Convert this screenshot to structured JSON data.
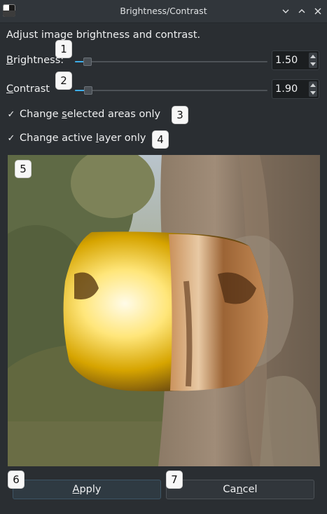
{
  "window": {
    "title": "Brightness/Contrast",
    "app_icon": "app-icon",
    "controls": [
      "chevron-down-icon",
      "chevron-up-icon",
      "close-icon"
    ]
  },
  "description": "Adjust image brightness and contrast.",
  "brightness": {
    "label": "Brightness:",
    "mnemonic": "B",
    "value": "1.50",
    "slider_fraction": 0.05
  },
  "contrast": {
    "label": "Contrast",
    "mnemonic": "C",
    "value": "1.90",
    "slider_fraction": 0.055
  },
  "options": {
    "selected_areas": {
      "label": "Change selected areas only",
      "checked": true
    },
    "active_layer": {
      "label": "Change active layer only",
      "checked": true
    }
  },
  "buttons": {
    "apply": "Apply",
    "cancel": "Cancel"
  },
  "badges": {
    "b1": "1",
    "b2": "2",
    "b3": "3",
    "b4": "4",
    "b5": "5",
    "b6": "6",
    "b7": "7"
  },
  "colors": {
    "accent": "#3daee9",
    "background": "#2a2e32",
    "text": "#eff0f1"
  }
}
